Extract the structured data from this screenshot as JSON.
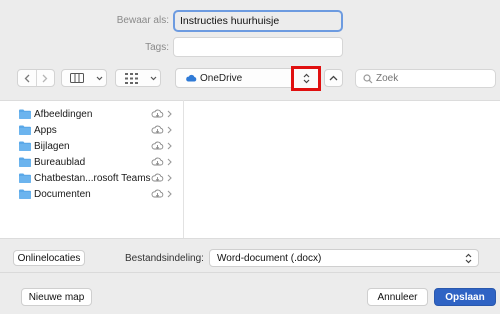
{
  "dialog": {
    "save_as_label": "Bewaar als:",
    "file_name": "Instructies huurhuisje",
    "tags_label": "Tags:",
    "tags_value": ""
  },
  "toolbar": {
    "location": "OneDrive",
    "search_placeholder": "Zoek"
  },
  "sidebar": {
    "items": [
      {
        "label": "Afbeeldingen"
      },
      {
        "label": "Apps"
      },
      {
        "label": "Bijlagen"
      },
      {
        "label": "Bureaublad"
      },
      {
        "label": "Chatbestan...rosoft Teams"
      },
      {
        "label": "Documenten"
      }
    ]
  },
  "options": {
    "online_locations_label": "Onlinelocaties",
    "format_label": "Bestandsindeling:",
    "format_value": "Word-document (.docx)"
  },
  "footer": {
    "new_folder_label": "Nieuwe map",
    "cancel_label": "Annuleer",
    "save_label": "Opslaan"
  },
  "colors": {
    "accent": "#2f63c4",
    "folder": "#5aa8e8",
    "highlight_box": "#e01010"
  }
}
